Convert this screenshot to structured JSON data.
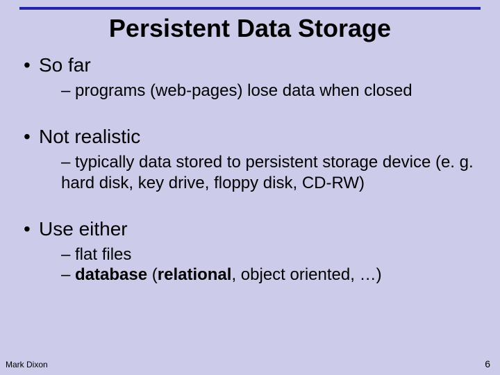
{
  "title": "Persistent Data Storage",
  "b1": {
    "label": "So far",
    "sub": "– programs (web-pages) lose data when closed"
  },
  "b2": {
    "label": "Not realistic",
    "sub": "– typically data stored to persistent storage device (e. g. hard disk, key drive, floppy disk, CD-RW)"
  },
  "b3": {
    "label": "Use either",
    "sub1_plain": "– flat files",
    "sub2_dash": "– ",
    "sub2_bold1": "database",
    "sub2_mid1": " (",
    "sub2_bold2": "relational",
    "sub2_mid2": ", object oriented, …)"
  },
  "footer": {
    "author": "Mark Dixon",
    "page": "6"
  }
}
